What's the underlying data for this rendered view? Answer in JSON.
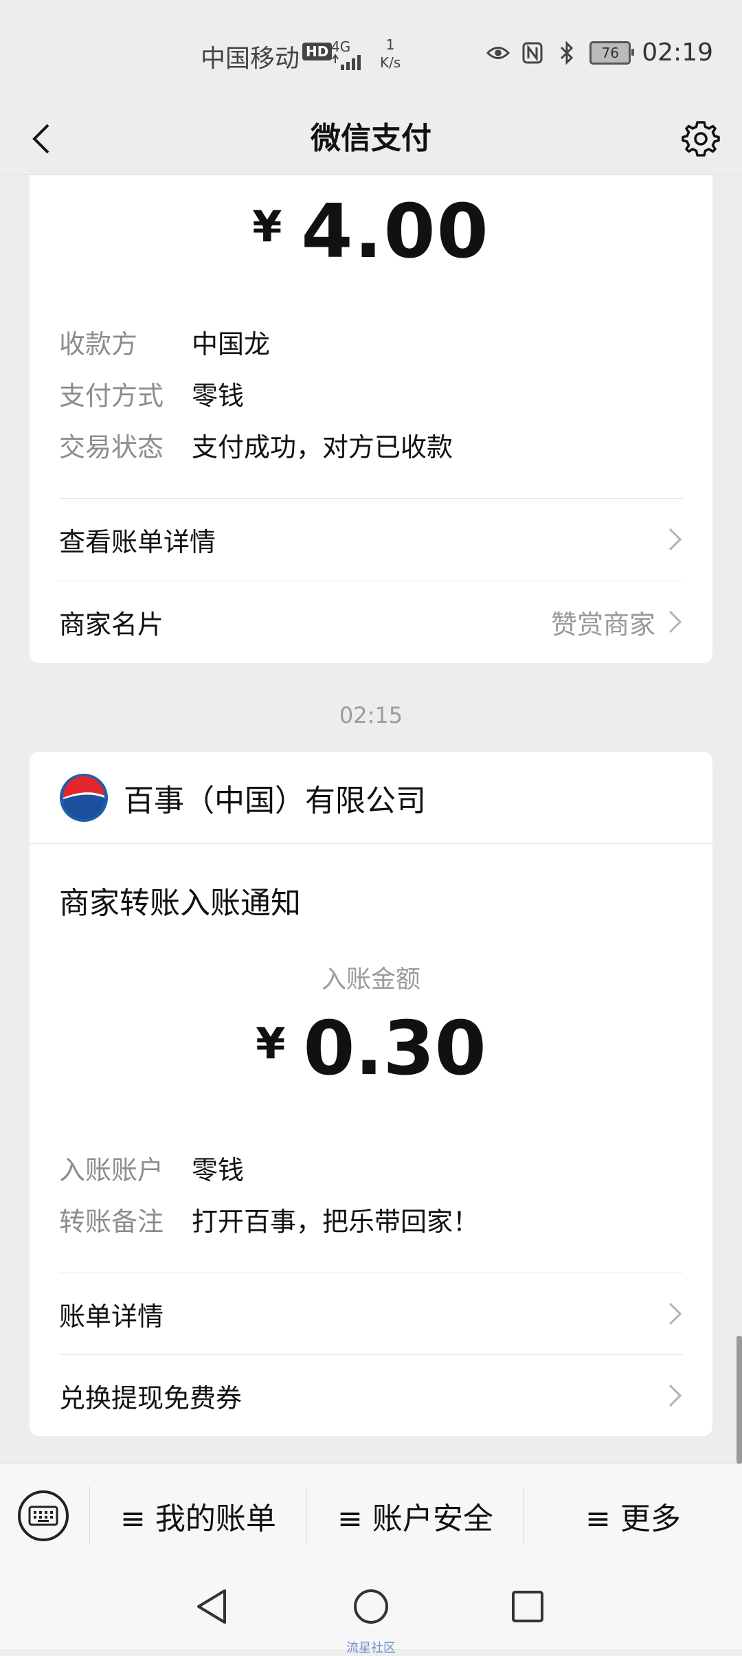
{
  "status_bar": {
    "carrier": "中国移动",
    "hd": "HD",
    "network": "4G",
    "speed_value": "1",
    "speed_unit": "K/s",
    "battery": "76",
    "time": "02:19"
  },
  "nav": {
    "title": "微信支付"
  },
  "payment_card": {
    "currency": "¥",
    "amount": "4.00",
    "fields": [
      {
        "key": "收款方",
        "value": "中国龙"
      },
      {
        "key": "支付方式",
        "value": "零钱"
      },
      {
        "key": "交易状态",
        "value": "支付成功，对方已收款"
      }
    ],
    "links": [
      {
        "label": "查看账单详情",
        "extra": ""
      },
      {
        "label": "商家名片",
        "extra": "赞赏商家"
      }
    ]
  },
  "timestamp": "02:15",
  "transfer_card": {
    "merchant_name": "百事（中国）有限公司",
    "title": "商家转账入账通知",
    "amount_caption": "入账金额",
    "currency": "¥",
    "amount": "0.30",
    "fields": [
      {
        "key": "入账账户",
        "value": "零钱"
      },
      {
        "key": "转账备注",
        "value": "打开百事，把乐带回家！"
      }
    ],
    "links": [
      {
        "label": "账单详情"
      },
      {
        "label": "兑换提现免费券"
      }
    ]
  },
  "bottom_menu": {
    "items": [
      "≡ 我的账单",
      "≡ 账户安全",
      "≡ 更多"
    ]
  },
  "system_nav": {
    "watermark": "流星社区"
  },
  "colors": {
    "background": "#ededed",
    "card": "#ffffff",
    "secondary_text": "#8c8c8c"
  },
  "icons": [
    "back-arrow-icon",
    "gear-icon",
    "eye-icon",
    "nfc-icon",
    "bluetooth-icon",
    "battery-icon",
    "chevron-right-icon",
    "pepsi-logo",
    "keyboard-icon",
    "triangle-back-icon",
    "circle-home-icon",
    "square-recents-icon"
  ]
}
